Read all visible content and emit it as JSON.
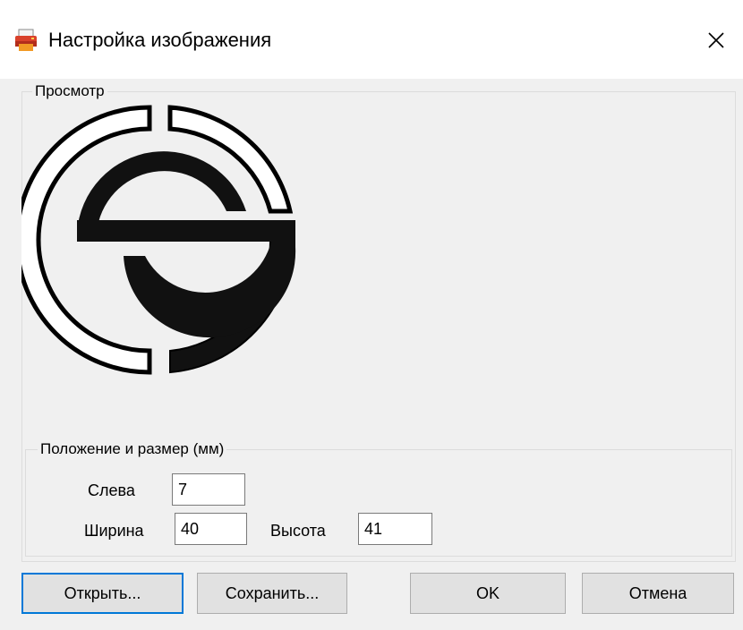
{
  "window": {
    "title": "Настройка изображения",
    "icon": "printer-app-icon",
    "close_icon": "close-icon"
  },
  "preview": {
    "legend": "Просмотр",
    "image": "S-logo-in-broken-ring"
  },
  "position": {
    "legend": "Положение и размер (мм)",
    "left_label": "Слева",
    "left_value": "7",
    "width_label": "Ширина",
    "width_value": "40",
    "height_label": "Высота",
    "height_value": "41"
  },
  "buttons": {
    "open": "Открыть...",
    "save": "Сохранить...",
    "ok": "OK",
    "cancel": "Отмена"
  },
  "colors": {
    "accent_border": "#0078d7",
    "icon_red": "#d9412b",
    "icon_orange": "#f29a25"
  }
}
